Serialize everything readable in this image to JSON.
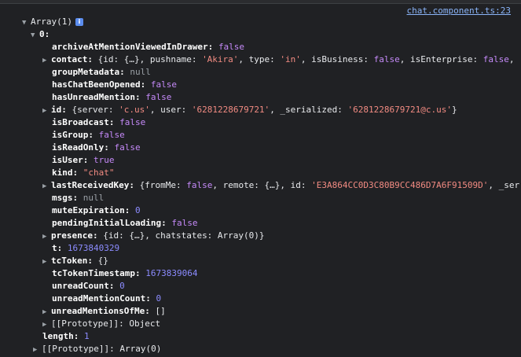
{
  "source_link": "chat.component.ts:23",
  "root": {
    "toggle": "▼",
    "label": "Array(1)",
    "info": "i"
  },
  "item0": {
    "toggle": "▼",
    "label": "0:"
  },
  "props": {
    "archiveAtMentionViewedInDrawer": {
      "key": "archiveAtMentionViewedInDrawer:",
      "value": "false"
    },
    "contact": {
      "toggle": "▶",
      "key": "contact:",
      "p1": "{id: {…}, pushname: ",
      "s1": "'Akira'",
      "p2": ", type: ",
      "s2": "'in'",
      "p3": ", isBusiness: ",
      "k1": "false",
      "p4": ", isEnterprise: ",
      "k2": "false",
      "p5": ","
    },
    "groupMetadata": {
      "key": "groupMetadata:",
      "value": "null"
    },
    "hasChatBeenOpened": {
      "key": "hasChatBeenOpened:",
      "value": "false"
    },
    "hasUnreadMention": {
      "key": "hasUnreadMention:",
      "value": "false"
    },
    "id": {
      "toggle": "▶",
      "key": "id:",
      "p1": "{server: ",
      "s1": "'c.us'",
      "p2": ", user: ",
      "s2": "'6281228679721'",
      "p3": ", _serialized: ",
      "s3": "'6281228679721@c.us'",
      "p4": "}"
    },
    "isBroadcast": {
      "key": "isBroadcast:",
      "value": "false"
    },
    "isGroup": {
      "key": "isGroup:",
      "value": "false"
    },
    "isReadOnly": {
      "key": "isReadOnly:",
      "value": "false"
    },
    "isUser": {
      "key": "isUser:",
      "value": "true"
    },
    "kind": {
      "key": "kind:",
      "value": "\"chat\""
    },
    "lastReceivedKey": {
      "toggle": "▶",
      "key": "lastReceivedKey:",
      "p1": "{fromMe: ",
      "k1": "false",
      "p2": ", remote: {…}, id: ",
      "s1": "'E3A864CC0D3C80B9CC486D7A6F91509D'",
      "p3": ", _ser"
    },
    "msgs": {
      "key": "msgs:",
      "value": "null"
    },
    "muteExpiration": {
      "key": "muteExpiration:",
      "value": "0"
    },
    "pendingInitialLoading": {
      "key": "pendingInitialLoading:",
      "value": "false"
    },
    "presence": {
      "toggle": "▶",
      "key": "presence:",
      "p1": "{id: {…}, chatstates: Array(0)}"
    },
    "t": {
      "key": "t:",
      "value": "1673840329"
    },
    "tcToken": {
      "toggle": "▶",
      "key": "tcToken:",
      "value": "{}"
    },
    "tcTokenTimestamp": {
      "key": "tcTokenTimestamp:",
      "value": "1673839064"
    },
    "unreadCount": {
      "key": "unreadCount:",
      "value": "0"
    },
    "unreadMentionCount": {
      "key": "unreadMentionCount:",
      "value": "0"
    },
    "unreadMentionsOfMe": {
      "toggle": "▶",
      "key": "unreadMentionsOfMe:",
      "value": "[]"
    },
    "prototype_inner": {
      "toggle": "▶",
      "key": "[[Prototype]]:",
      "value": "Object"
    }
  },
  "length": {
    "key": "length:",
    "value": "1"
  },
  "prototype_outer": {
    "toggle": "▶",
    "key": "[[Prototype]]:",
    "value": "Array(0)"
  }
}
